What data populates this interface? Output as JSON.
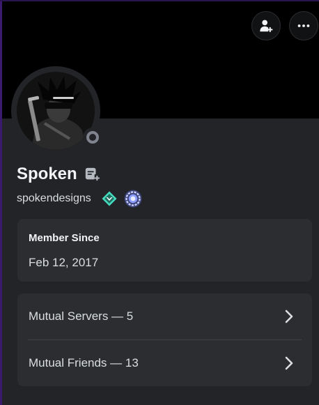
{
  "profile": {
    "display_name": "Spoken",
    "username": "spokendesigns",
    "status": "offline"
  },
  "actions": {
    "add_friend_icon": "add-friend-icon",
    "more_icon": "more-options-icon"
  },
  "badges": [
    {
      "name": "hypesquad-balance-badge",
      "color": "#45ddc0"
    },
    {
      "name": "nitro-tenure-badge",
      "color": "#8b9cff"
    }
  ],
  "member_since": {
    "heading": "Member Since",
    "date": "Feb 12, 2017"
  },
  "mutuals": {
    "servers_label": "Mutual Servers — 5",
    "friends_label": "Mutual Friends — 13"
  },
  "colors": {
    "banner": "#000000",
    "card": "#2b2d31",
    "background": "#232428",
    "frame": "#3b1a6e"
  }
}
